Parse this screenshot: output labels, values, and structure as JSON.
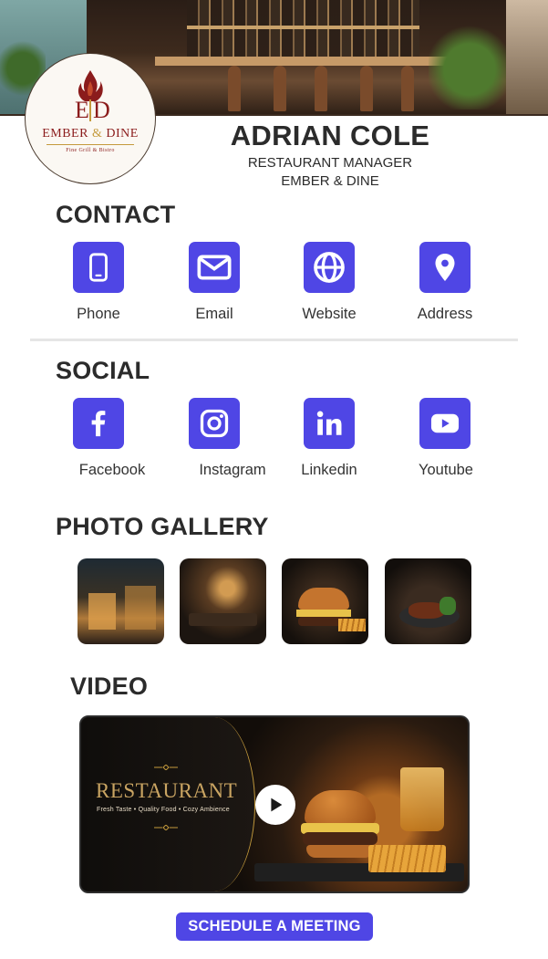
{
  "profile": {
    "name": "ADRIAN COLE",
    "role": "RESTAURANT MANAGER",
    "company": "EMBER & DINE"
  },
  "logo": {
    "monogram": "ED",
    "name_part1": "EMBER",
    "name_amp": "&",
    "name_part2": "DINE",
    "tagline": "Fine Grill & Bistro"
  },
  "contact": {
    "heading": "CONTACT",
    "items": [
      {
        "label": "Phone",
        "icon": "phone-icon"
      },
      {
        "label": "Email",
        "icon": "email-icon"
      },
      {
        "label": "Website",
        "icon": "globe-icon"
      },
      {
        "label": "Address",
        "icon": "location-pin-icon"
      }
    ]
  },
  "social": {
    "heading": "SOCIAL",
    "items": [
      {
        "label": "Facebook",
        "icon": "facebook-icon"
      },
      {
        "label": "Instagram",
        "icon": "instagram-icon"
      },
      {
        "label": "Linkedin",
        "icon": "linkedin-icon"
      },
      {
        "label": "Youtube",
        "icon": "youtube-icon"
      }
    ]
  },
  "gallery": {
    "heading": "PHOTO GALLERY",
    "photos": [
      {
        "subject": "restaurant exterior at night"
      },
      {
        "subject": "dining room interior"
      },
      {
        "subject": "burger and fries"
      },
      {
        "subject": "grilled steak plate"
      }
    ]
  },
  "video": {
    "heading": "VIDEO",
    "overlay_title": "RESTAURANT",
    "overlay_subtitle": "Fresh Taste  •  Quality Food  •  Cozy Ambience"
  },
  "cta": {
    "label": "SCHEDULE A MEETING"
  },
  "colors": {
    "accent": "#4f46e5",
    "heading_text": "#2b2b2b",
    "gold": "#c49a3c",
    "brand_red": "#8b1c1c"
  }
}
